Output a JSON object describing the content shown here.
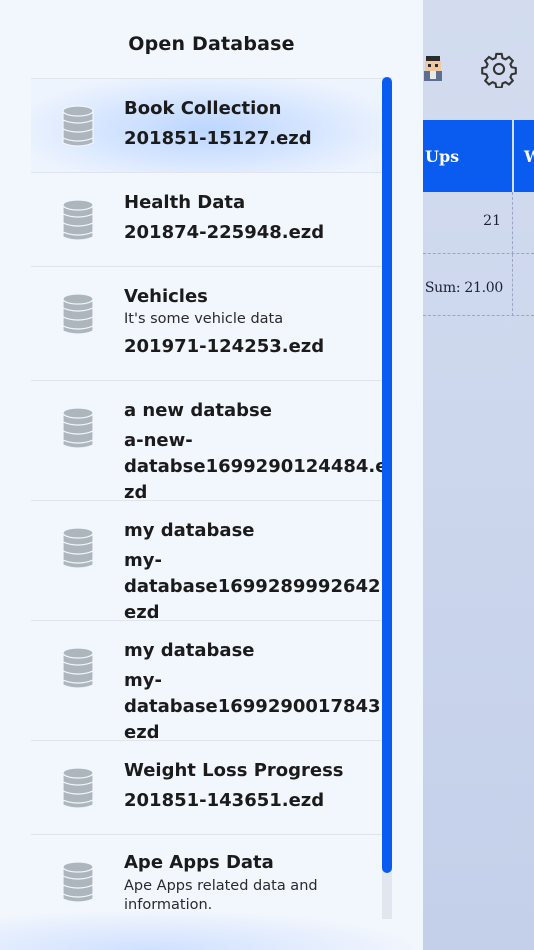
{
  "background": {
    "table": {
      "header_col1": "Ups",
      "header_col2": "W",
      "row1_value": "21",
      "sum_value": "Sum: 21.00"
    },
    "icons": [
      "avatar-icon",
      "gear-icon"
    ]
  },
  "drawer": {
    "title": "Open Database",
    "items": [
      {
        "name": "Book Collection",
        "description": "",
        "file": "201851-15127.ezd",
        "active": true
      },
      {
        "name": "Health Data",
        "description": "",
        "file": "201874-225948.ezd",
        "active": false
      },
      {
        "name": "Vehicles",
        "description": "It's some vehicle data",
        "file": "201971-124253.ezd",
        "active": false
      },
      {
        "name": "a new databse",
        "description": "",
        "file": "a-new-\ndatabse1699290124484.ezd",
        "active": false
      },
      {
        "name": "my database",
        "description": "",
        "file": "my-\ndatabase1699289992642.ezd",
        "active": false
      },
      {
        "name": "my database",
        "description": "",
        "file": "my-\ndatabase1699290017843.ezd",
        "active": false
      },
      {
        "name": "Weight Loss Progress",
        "description": "",
        "file": "201851-143651.ezd",
        "active": false
      },
      {
        "name": "Ape Apps Data",
        "description": "Ape Apps related data and information.",
        "file": "",
        "active": false
      }
    ]
  },
  "colors": {
    "accent": "#0a5bf0",
    "drawer_bg": "#f2f6fd",
    "icon_gray": "#aeb6bd"
  }
}
